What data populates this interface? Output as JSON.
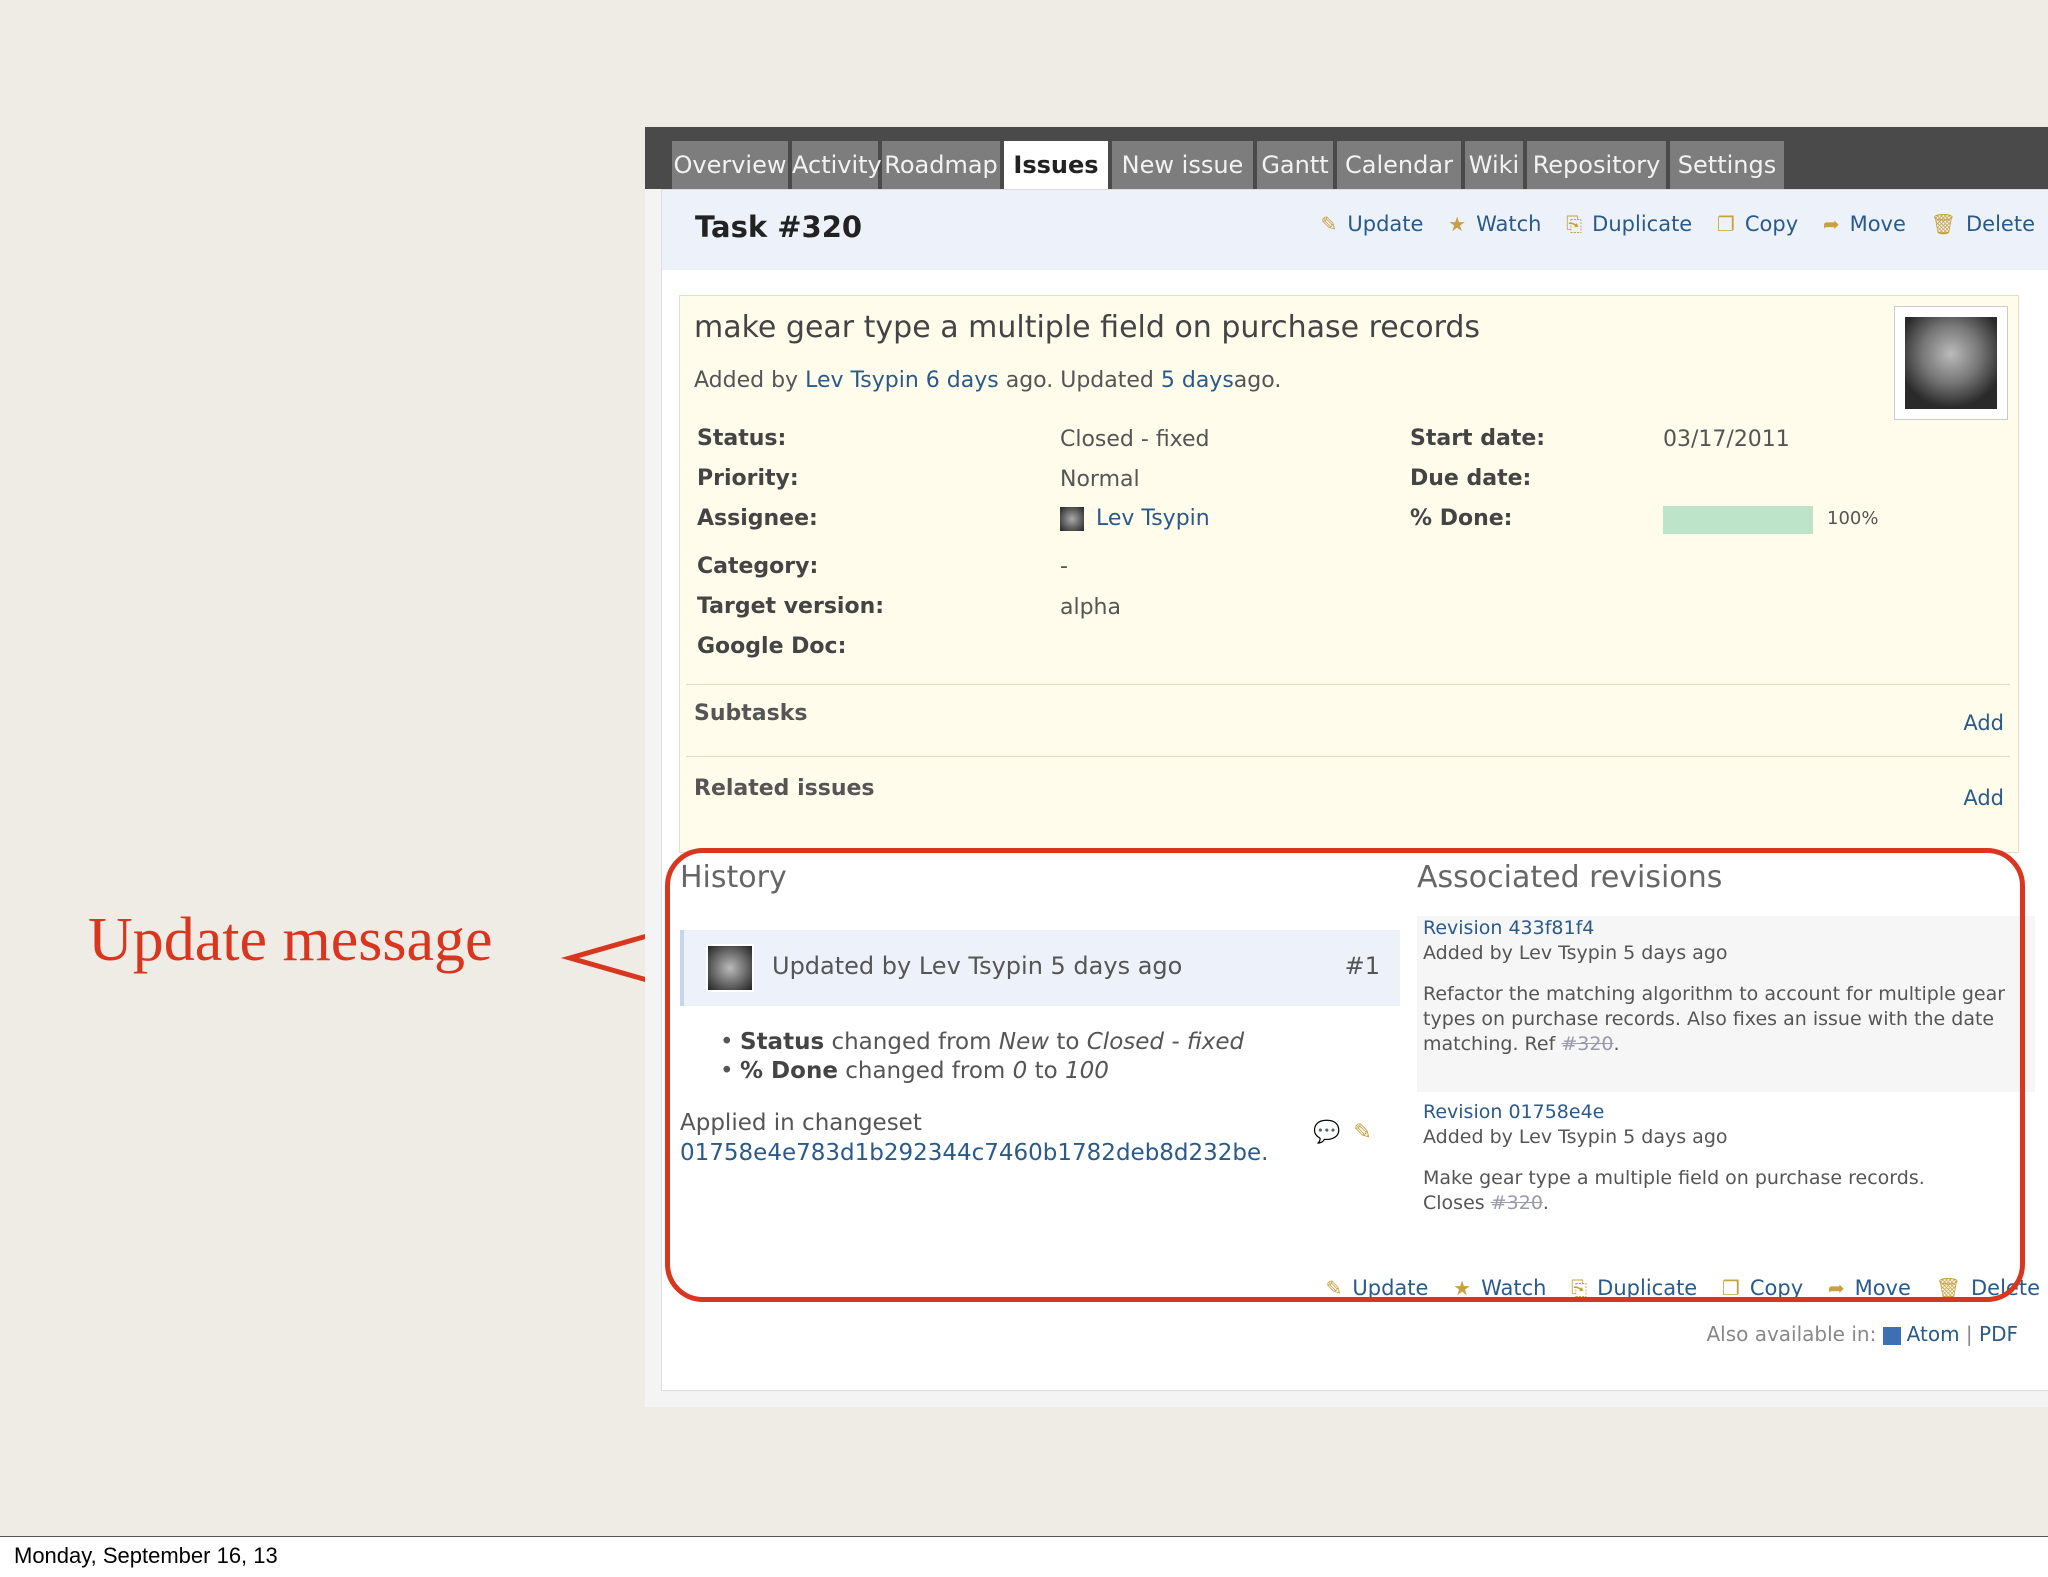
{
  "tabs": [
    "Overview",
    "Activity",
    "Roadmap",
    "Issues",
    "New issue",
    "Gantt",
    "Calendar",
    "Wiki",
    "Repository",
    "Settings"
  ],
  "active_tab": "Issues",
  "issue": {
    "title": "Task #320",
    "subject": "make gear type a multiple field on purchase records",
    "author_prefix": "Added by",
    "author": "Lev Tsypin",
    "added_ago": "6 days",
    "updated_prefix": "ago. Updated",
    "updated_ago": "5 days",
    "author_suffix": "ago.",
    "fields": {
      "status_label": "Status:",
      "status": "Closed - fixed",
      "priority_label": "Priority:",
      "priority": "Normal",
      "assignee_label": "Assignee:",
      "assignee": "Lev Tsypin",
      "category_label": "Category:",
      "category": "-",
      "target_version_label": "Target version:",
      "target_version": "alpha",
      "google_doc_label": "Google Doc:",
      "start_date_label": "Start date:",
      "start_date": "03/17/2011",
      "due_date_label": "Due date:",
      "done_label": "% Done:",
      "done_text": "100%",
      "done_fraction": 1.0
    },
    "subtasks_label": "Subtasks",
    "related_label": "Related issues",
    "add_label": "Add"
  },
  "actions": {
    "update": "Update",
    "watch": "Watch",
    "duplicate": "Duplicate",
    "copy": "Copy",
    "move": "Move",
    "delete": "Delete"
  },
  "history": {
    "title": "History",
    "journal_header": "Updated by Lev Tsypin 5 days ago",
    "journal_number": "#1",
    "details": [
      {
        "field": "Status",
        "text1": "changed from",
        "from": "New",
        "text2": "to",
        "to": "Closed - fixed"
      },
      {
        "field": "% Done",
        "text1": "changed from",
        "from": "0",
        "text2": "to",
        "to": "100"
      }
    ],
    "changeset_text": "Applied in changeset",
    "changeset_hash": "01758e4e783d1b292344c7460b1782deb8d232be."
  },
  "revisions": {
    "title": "Associated revisions",
    "items": [
      {
        "link": "Revision 433f81f4",
        "added": "Added by Lev Tsypin 5 days ago",
        "message": "Refactor the matching algorithm to account for multiple gear types on purchase records. Also fixes an issue with the date matching. Ref",
        "ref": "#320",
        "tail": "."
      },
      {
        "link": "Revision 01758e4e",
        "added": "Added by Lev Tsypin 5 days ago",
        "message": "Make gear type a multiple field on purchase records. Closes",
        "ref": "#320",
        "tail": "."
      }
    ]
  },
  "other_formats": {
    "label": "Also available in:",
    "atom": "Atom",
    "sep": "|",
    "pdf": "PDF"
  },
  "annotation": {
    "text": "Update message",
    "color": "#d9361f"
  },
  "footer": {
    "date": "Monday, September 16, 13"
  },
  "colors": {
    "link": "#2a5a8a",
    "tabbar": "#4a4a4a",
    "issue_bg": "#fffcec",
    "progress": "#bde3c8"
  }
}
